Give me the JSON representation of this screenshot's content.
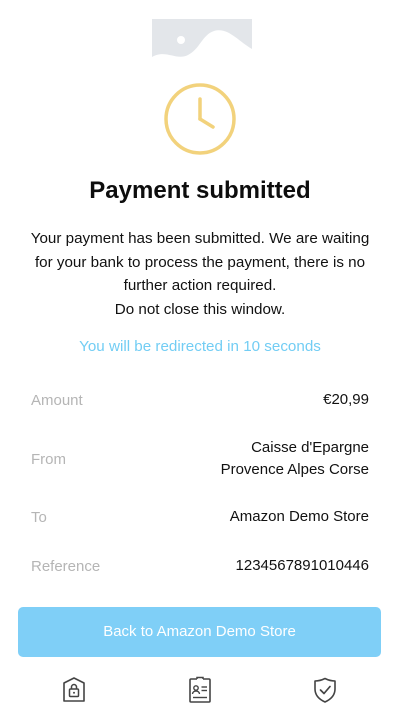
{
  "header": {
    "logo_icon": "image-placeholder-icon",
    "status_icon": "clock-icon"
  },
  "title": "Payment submitted",
  "message": {
    "line1": "Your payment has been submitted. We are waiting for your bank to process the payment, there is no further action required.",
    "line2": "Do not close this window."
  },
  "redirect_text": "You will be redirected in 10 seconds",
  "details": {
    "amount_label": "Amount",
    "amount_value": "€20,99",
    "from_label": "From",
    "from_value_line1": "Caisse d'Epargne",
    "from_value_line2": "Provence Alpes Corse",
    "to_label": "To",
    "to_value": "Amazon Demo Store",
    "reference_label": "Reference",
    "reference_value": "1234567891010446"
  },
  "cta": {
    "label": "Back to Amazon Demo Store"
  },
  "footer": {
    "icons": [
      "secure-lock-icon",
      "id-card-icon",
      "shield-check-icon"
    ]
  },
  "colors": {
    "accent": "#72cdf4",
    "button": "#7fcff7",
    "clock": "#f2d27c",
    "label_grey": "#b5b5b5",
    "placeholder_bg": "#e3e6ea",
    "footer_icon": "#444444"
  }
}
